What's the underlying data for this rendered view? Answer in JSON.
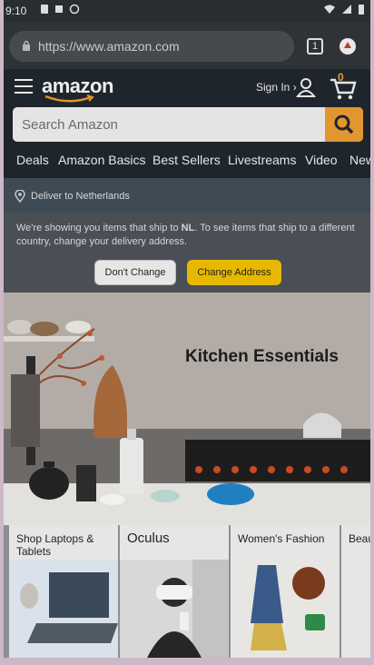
{
  "status_bar": {
    "time": "9:10"
  },
  "browser": {
    "url": "https://www.amazon.com",
    "tab_count": "1"
  },
  "header": {
    "logo": "amazon",
    "sign_in": "Sign In ›",
    "cart_count": "0",
    "search_placeholder": "Search Amazon"
  },
  "nav": {
    "items": [
      "Deals",
      "Amazon Basics",
      "Best Sellers",
      "Livestreams",
      "Video",
      "New"
    ]
  },
  "deliver": {
    "text": "Deliver to Netherlands"
  },
  "notice": {
    "text_before": "We're showing you items that ship to ",
    "country": "NL",
    "text_after": ". To see items that ship to a different country, change your delivery address.",
    "dont_change": "Don't Change",
    "change_address": "Change Address"
  },
  "hero": {
    "title": "Kitchen Essentials"
  },
  "cards": [
    {
      "title": "Shop Laptops & Tablets"
    },
    {
      "title": "Oculus"
    },
    {
      "title": "Women's Fashion"
    },
    {
      "title": "Beauty Picks"
    }
  ],
  "colors": {
    "accent": "#e2962f",
    "header_bg": "#1f252c",
    "change_btn": "#e6b800"
  }
}
